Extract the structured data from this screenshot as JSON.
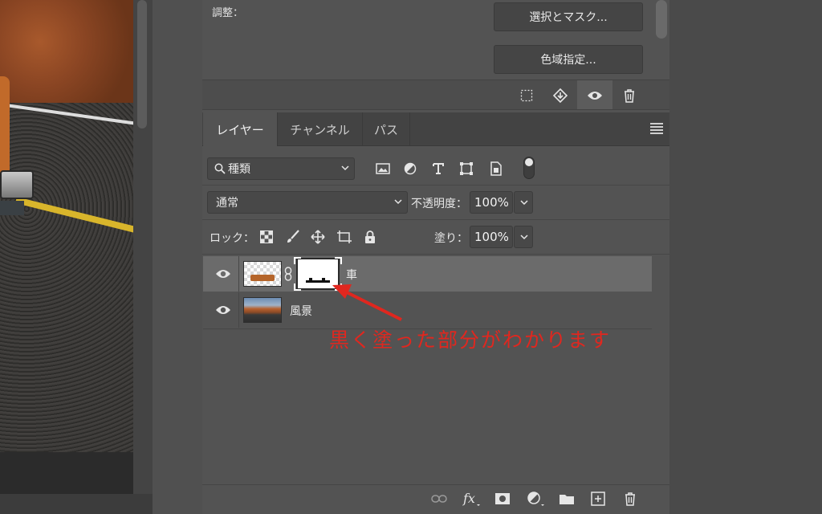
{
  "properties": {
    "adjust_label": "調整：",
    "select_and_mask": "選択とマスク...",
    "color_range": "色域指定..."
  },
  "layers_panel": {
    "tabs": [
      {
        "label": "レイヤー",
        "active": true
      },
      {
        "label": "チャンネル",
        "active": false
      },
      {
        "label": "パス",
        "active": false
      }
    ],
    "filter": {
      "value": "種類",
      "icon": "search-icon"
    },
    "filter_icons": [
      "image-filter-icon",
      "adjustment-filter-icon",
      "type-filter-icon",
      "shape-filter-icon",
      "smart-object-filter-icon"
    ],
    "blend_mode": "通常",
    "opacity_label": "不透明度：",
    "opacity": "100%",
    "lock_label": "ロック：",
    "fill_label": "塗り：",
    "fill": "100%",
    "layers": [
      {
        "name": "車",
        "selected": true,
        "has_mask": true
      },
      {
        "name": "風景",
        "selected": false,
        "has_mask": false
      }
    ]
  },
  "annotation": {
    "text": "黒く塗った部分がわかります",
    "color": "#e0271f"
  },
  "colors": {
    "panel_bg": "#535353",
    "selected_row": "#6b6b6b",
    "accent_red": "#e0271f"
  }
}
